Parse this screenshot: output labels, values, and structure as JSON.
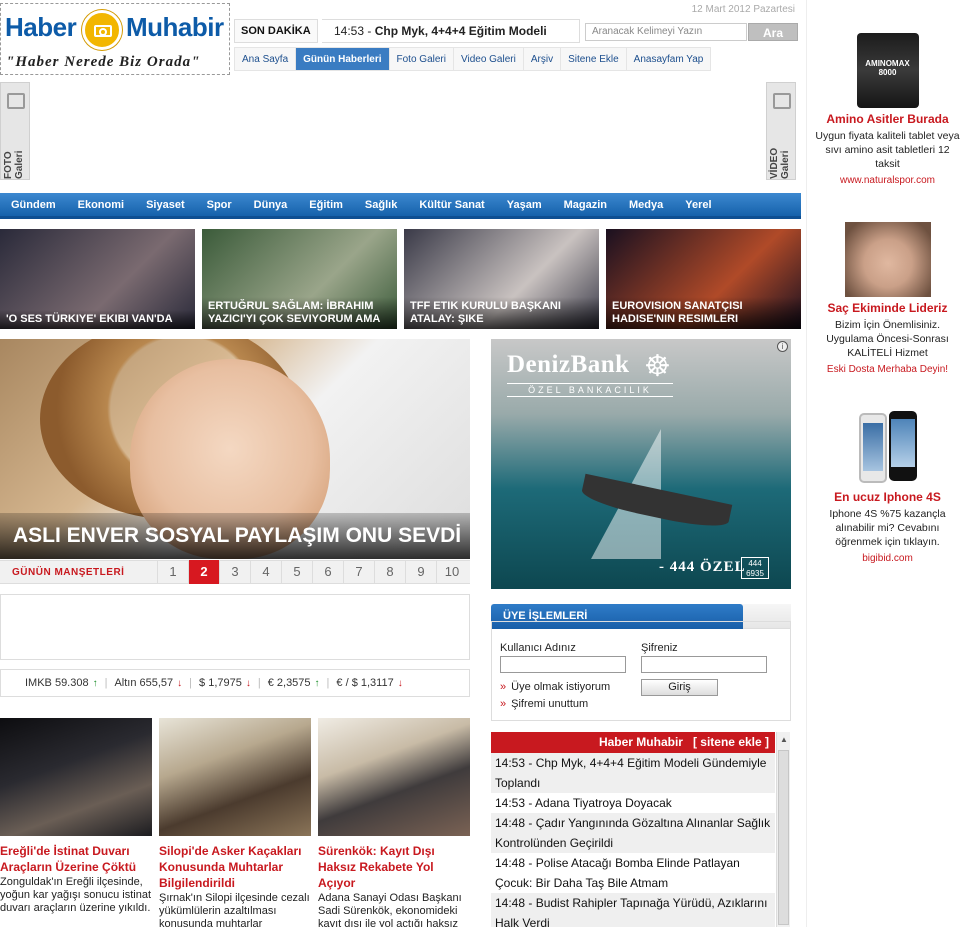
{
  "header": {
    "logo_left": "Haber",
    "logo_right": "Muhabir",
    "slogan": "\"Haber Nerede Biz Orada\"",
    "date": "12 Mart 2012 Pazartesi",
    "breaking_label": "SON DAKİKA",
    "breaking_time": "14:53 -",
    "breaking_text": "Chp Myk, 4+4+4 Eğitim Modeli",
    "search_placeholder": "Aranacak Kelimeyi Yazın",
    "search_button": "Ara"
  },
  "topnav": [
    {
      "label": "Ana Sayfa",
      "active": false
    },
    {
      "label": "Günün Haberleri",
      "active": true
    },
    {
      "label": "Foto Galeri",
      "active": false
    },
    {
      "label": "Video Galeri",
      "active": false
    },
    {
      "label": "Arşiv",
      "active": false
    },
    {
      "label": "Sitene Ekle",
      "active": false
    },
    {
      "label": "Anasayfam Yap",
      "active": false
    }
  ],
  "side_galleries": {
    "foto": "FOTO Galeri",
    "video": "VİDEO Galeri"
  },
  "categories": [
    "Gündem",
    "Ekonomi",
    "Siyaset",
    "Spor",
    "Dünya",
    "Eğitim",
    "Sağlık",
    "Kültür Sanat",
    "Yaşam",
    "Magazin",
    "Medya",
    "Yerel"
  ],
  "thumbs": [
    {
      "caption": "'O Ses Türkiye' ekibi Van'da",
      "color1": "#2a2a3a",
      "color2": "#7a6a70"
    },
    {
      "caption": "Ertuğrul Sağlam: İbrahim Yazıcı'yı çok seviyorum ama",
      "color1": "#3b5b3a",
      "color2": "#9aa58a"
    },
    {
      "caption": "TFF Etik Kurulu Başkanı Atalay: Şike",
      "color1": "#3a3a48",
      "color2": "#c9c2c0"
    },
    {
      "caption": "Eurovision sanatçısı Hadise'nin resimleri",
      "color1": "#1a1020",
      "color2": "#b04a28"
    }
  ],
  "headline": {
    "caption": "ASLI ENVER SOSYAL PAYLAŞIM ONU SEVDİ",
    "pager_label": "GÜNÜN MANŞETLERİ",
    "pages": [
      "1",
      "2",
      "3",
      "4",
      "5",
      "6",
      "7",
      "8",
      "9",
      "10"
    ],
    "active_page": "2"
  },
  "market": [
    {
      "label": "IMKB 59.308",
      "dir": "up"
    },
    {
      "label": "Altın 655,57",
      "dir": "down"
    },
    {
      "label": "$ 1,7975",
      "dir": "down"
    },
    {
      "label": "€ 2,3575",
      "dir": "up"
    },
    {
      "label": "€ / $ 1,3117",
      "dir": "down"
    }
  ],
  "news": [
    {
      "title": "Ereğli'de İstinat Duvarı Araçların Üzerine Çöktü",
      "desc": "Zonguldak'ın Ereğli ilçesinde, yoğun kar yağışı sonucu istinat duvarı araçların üzerine yıkıldı."
    },
    {
      "title": "Silopi'de Asker Kaçakları Konusunda Muhtarlar Bilgilendirildi",
      "desc": "Şırnak'ın Silopi ilçesinde cezalı yükümlülerin azaltılması konusunda muhtarlar"
    },
    {
      "title": "Sürenkök: Kayıt Dışı Haksız Rekabete Yol Açıyor",
      "desc": "Adana Sanayi Odası Başkanı Sadi Sürenkök, ekonomideki kayıt dışı ile yol açtığı haksız rekabetin en önemli sorun olma"
    }
  ],
  "bank_ad": {
    "name": "DenizBank",
    "sub": "ÖZEL BANKACILIK",
    "phone": "- 444 ÖZEL",
    "box": "444 6935",
    "info": "i"
  },
  "login": {
    "title": "ÜYE İŞLEMLERİ",
    "user_label": "Kullanıcı Adınız",
    "pass_label": "Şifreniz",
    "submit": "Giriş",
    "register": "Üye olmak istiyorum",
    "forgot": "Şifremi unuttum"
  },
  "feed": {
    "title": "Haber Muhabir",
    "add": "[ sitene ekle ]",
    "items": [
      "14:53 - Chp Myk, 4+4+4 Eğitim Modeli Gündemiyle Toplandı",
      "14:53 - Adana Tiyatroya Doyacak",
      "14:48 - Çadır Yangınında Gözaltına Alınanlar Sağlık Kontrolünden Geçirildi",
      "14:48 - Polise Atacağı Bomba Elinde Patlayan Çocuk: Bir Daha Taş Bile Atmam",
      "14:48 - Budist Rahipler Tapınağa Yürüdü, Azıklarını Halk Verdi"
    ]
  },
  "right_ads": [
    {
      "title": "Amino Asitler Burada",
      "desc": "Uygun fiyata kaliteli tablet veya sıvı amino asit tabletleri 12 taksit",
      "url": "www.naturalspor.com",
      "img_text": "AMINOMAX 8000"
    },
    {
      "title": "Saç Ekiminde Lideriz",
      "desc": "Bizim İçin Önemlisiniz. Uygulama Öncesi-Sonrası KALİTELİ Hizmet",
      "url": "Eski Dosta Merhaba Deyin!",
      "img_text": ""
    },
    {
      "title": "En ucuz Iphone 4S",
      "desc": "Iphone 4S %75 kazançla alınabilir mi? Cevabını öğrenmek için tıklayın.",
      "url": "bigibid.com",
      "img_text": ""
    }
  ]
}
